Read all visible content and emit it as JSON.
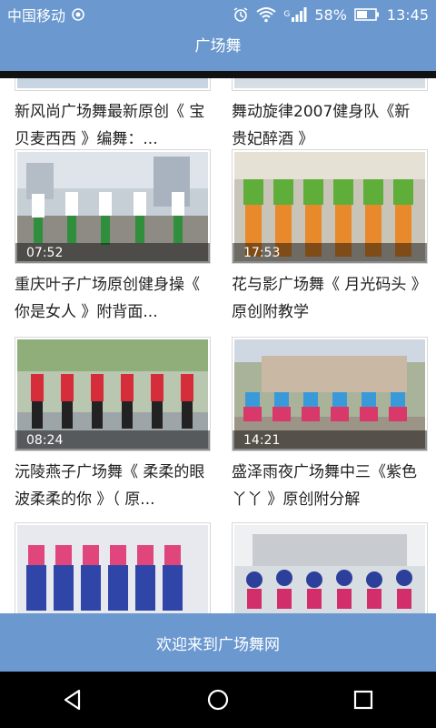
{
  "status_bar": {
    "carrier": "中国移动",
    "battery": "58%",
    "time": "13:45",
    "network_label": "G"
  },
  "app_bar": {
    "title": "广场舞"
  },
  "videos": [
    {
      "duration": "",
      "title": "新风尚广场舞最新原创《 宝贝麦西西 》编舞：..."
    },
    {
      "duration": "",
      "title": "舞动旋律2007健身队《新贵妃醉酒 》"
    },
    {
      "duration": "07:52",
      "title": "重庆叶子广场原创健身操《 你是女人 》附背面..."
    },
    {
      "duration": "17:53",
      "title": "花与影广场舞《 月光码头 》原创附教学"
    },
    {
      "duration": "08:24",
      "title": "沅陵燕子广场舞《 柔柔的眼波柔柔的你 》（ 原..."
    },
    {
      "duration": "14:21",
      "title": "盛泽雨夜广场舞中三《紫色丫丫 》原创附分解"
    },
    {
      "duration": "",
      "title": ""
    },
    {
      "duration": "",
      "title": ""
    }
  ],
  "bottom_bar": {
    "label": "欢迎来到广场舞网"
  },
  "colors": {
    "bar": "#6a98cf",
    "nav": "#000000"
  },
  "icons": {
    "status": [
      "signal-info-icon",
      "alarm-icon",
      "wifi-icon",
      "cell-signal-icon",
      "battery-icon"
    ],
    "nav": [
      "back-icon",
      "home-icon",
      "recents-icon"
    ]
  }
}
